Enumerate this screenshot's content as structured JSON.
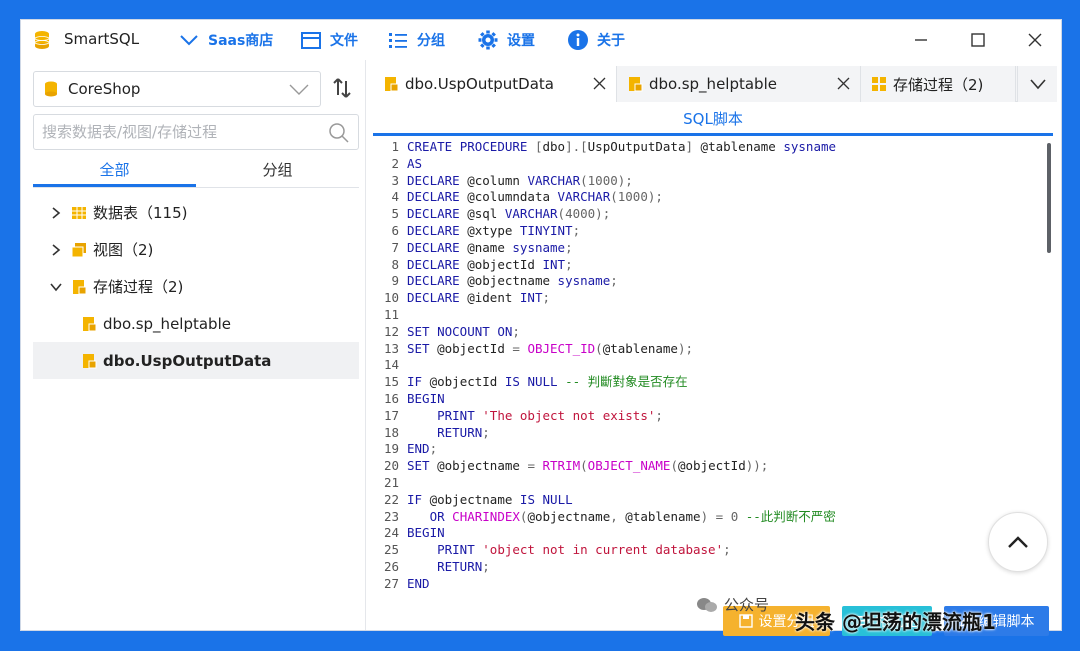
{
  "titlebar": {
    "app_title": "SmartSQL",
    "menu": [
      {
        "label": "Saas商店",
        "icon": "chevron-down-icon"
      },
      {
        "label": "文件",
        "icon": "folder-icon"
      },
      {
        "label": "分组",
        "icon": "list-icon"
      },
      {
        "label": "设置",
        "icon": "gear-icon"
      },
      {
        "label": "关于",
        "icon": "info-icon"
      }
    ],
    "controls": [
      "minimize",
      "maximize",
      "close"
    ]
  },
  "sidebar": {
    "database": "CoreShop",
    "search_placeholder": "搜索数据表/视图/存储过程",
    "tabs": [
      {
        "label": "全部",
        "active": true
      },
      {
        "label": "分组",
        "active": false
      }
    ],
    "tree": [
      {
        "label": "数据表（115)",
        "expanded": false
      },
      {
        "label": "视图（2)",
        "expanded": false
      },
      {
        "label": "存储过程（2)",
        "expanded": true
      }
    ],
    "procedures": [
      {
        "label": "dbo.sp_helptable",
        "selected": false
      },
      {
        "label": "dbo.UspOutputData",
        "selected": true
      }
    ]
  },
  "editor": {
    "tabs": [
      {
        "label": "dbo.UspOutputData",
        "active": true
      },
      {
        "label": "dbo.sp_helptable",
        "active": false
      },
      {
        "label": "存储过程（2)",
        "active": false
      }
    ],
    "section_title": "SQL脚本",
    "lines": [
      "CREATE PROCEDURE [dbo].[UspOutputData] @tablename sysname",
      "AS",
      "DECLARE @column VARCHAR(1000);",
      "DECLARE @columndata VARCHAR(1000);",
      "DECLARE @sql VARCHAR(4000);",
      "DECLARE @xtype TINYINT;",
      "DECLARE @name sysname;",
      "DECLARE @objectId INT;",
      "DECLARE @objectname sysname;",
      "DECLARE @ident INT;",
      "",
      "SET NOCOUNT ON;",
      "SET @objectId = OBJECT_ID(@tablename);",
      "",
      "IF @objectId IS NULL -- 判斷對象是否存在",
      "BEGIN",
      "    PRINT 'The object not exists';",
      "    RETURN;",
      "END;",
      "SET @objectname = RTRIM(OBJECT_NAME(@objectId));",
      "",
      "IF @objectname IS NULL",
      "   OR CHARINDEX(@objectname, @tablename) = 0 --此判断不严密",
      "BEGIN",
      "    PRINT 'object not in current database';",
      "    RETURN;",
      "END"
    ],
    "buttons": {
      "save": "设置分组",
      "format": "格式化",
      "edit": "编辑脚本"
    }
  },
  "watermark": {
    "main": "头条 @坦荡的漂流瓶1",
    "wechat": "公众号"
  },
  "colors": {
    "accent": "#1a73e8",
    "save_button": "#f5b22e",
    "format_button": "#28c0d8",
    "edit_button": "#2d7be8"
  }
}
